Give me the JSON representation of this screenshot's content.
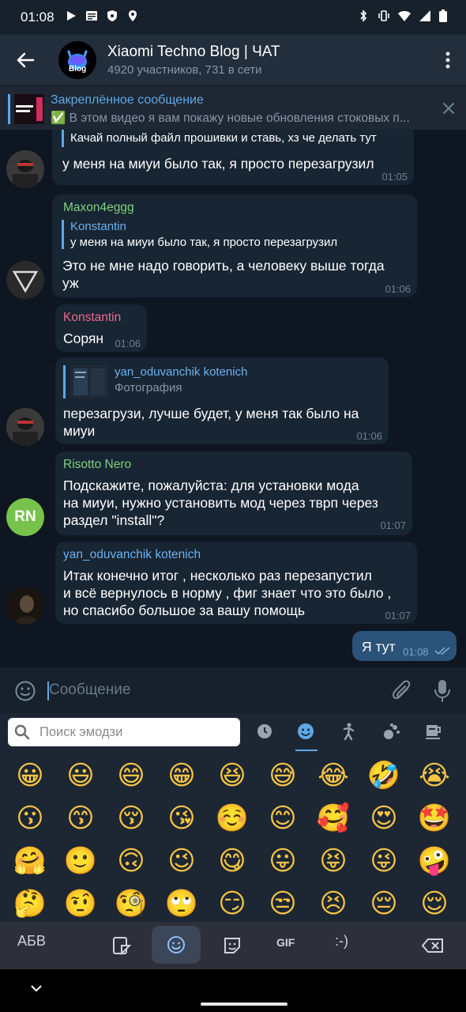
{
  "status": {
    "time": "01:08"
  },
  "header": {
    "title": "Xiaomi Techno Blog | ЧАТ",
    "subtitle": "4920 участников, 731 в сети",
    "avatar_text": "Blog"
  },
  "pinned": {
    "title": "Закреплённое сообщение",
    "text": "✅ В этом видео я вам покажу новые обновления стоковых п..."
  },
  "messages": [
    {
      "reply_text": "Качай полный файл прошивки и ставь, хз че делать тут",
      "text": "у меня на миуи было так, я просто перезагрузил",
      "time": "01:05"
    },
    {
      "sender": "Maxon4eggg",
      "sender_color": "#7fd37f",
      "reply_name": "Konstantin",
      "reply_text": "у меня на миуи было так, я просто перезагрузил",
      "text_line1": "Это не мне надо говорить, а человеку выше тогда",
      "text_line2": "уж",
      "time": "01:06"
    },
    {
      "sender": "Konstantin",
      "sender_color": "#e96a8d",
      "text": "Сорян",
      "time": "01:06"
    },
    {
      "reply_name": "yan_oduvanchik kotenich",
      "reply_text": "Фотография",
      "text_line1": "перезагрузи, лучше будет, у меня так было на",
      "text_line2": "миуи",
      "time": "01:06"
    },
    {
      "sender": "Risotto Nero",
      "sender_color": "#7fd37f",
      "avatar_initials": "RN",
      "text_line1": "Подскажите, пожалуйста: для установки мода",
      "text_line2": "на миуи, нужно установить мод через тврп через",
      "text_line3": "раздел \"install\"?",
      "time": "01:07"
    },
    {
      "sender": "yan_oduvanchik kotenich",
      "sender_color": "#6ab2f2",
      "text_line1": "Итак конечно итог , несколько раз перезапустил",
      "text_line2": "и всё вернулось в норму , фиг знает что это было ,",
      "text_line3": "но спасибо большое за вашу помощь",
      "time": "01:07"
    },
    {
      "text": "Я тут",
      "time": "01:08",
      "outgoing": true
    }
  ],
  "input": {
    "placeholder": "Сообщение"
  },
  "emoji_panel": {
    "search_placeholder": "Поиск эмодзи",
    "emojis": [
      "😀",
      "😃",
      "😄",
      "😁",
      "😆",
      "😅",
      "😂",
      "🤣",
      "😭",
      "😗",
      "😙",
      "😚",
      "😘",
      "☺️",
      "😊",
      "🥰",
      "😍",
      "🤩",
      "🤗",
      "🙂",
      "🙃",
      "😉",
      "😋",
      "😛",
      "😝",
      "😜",
      "🤪",
      "🤔",
      "🤨",
      "🧐",
      "🙄",
      "😏",
      "😒",
      "😣",
      "😔",
      "😌"
    ]
  },
  "keyboard": {
    "abc": "АБВ",
    "gif": "GIF",
    "emoticon": ":-)"
  },
  "colors": {
    "accent": "#5ea9e6",
    "bubble_in": "#182533",
    "bubble_out": "#2b5278"
  }
}
